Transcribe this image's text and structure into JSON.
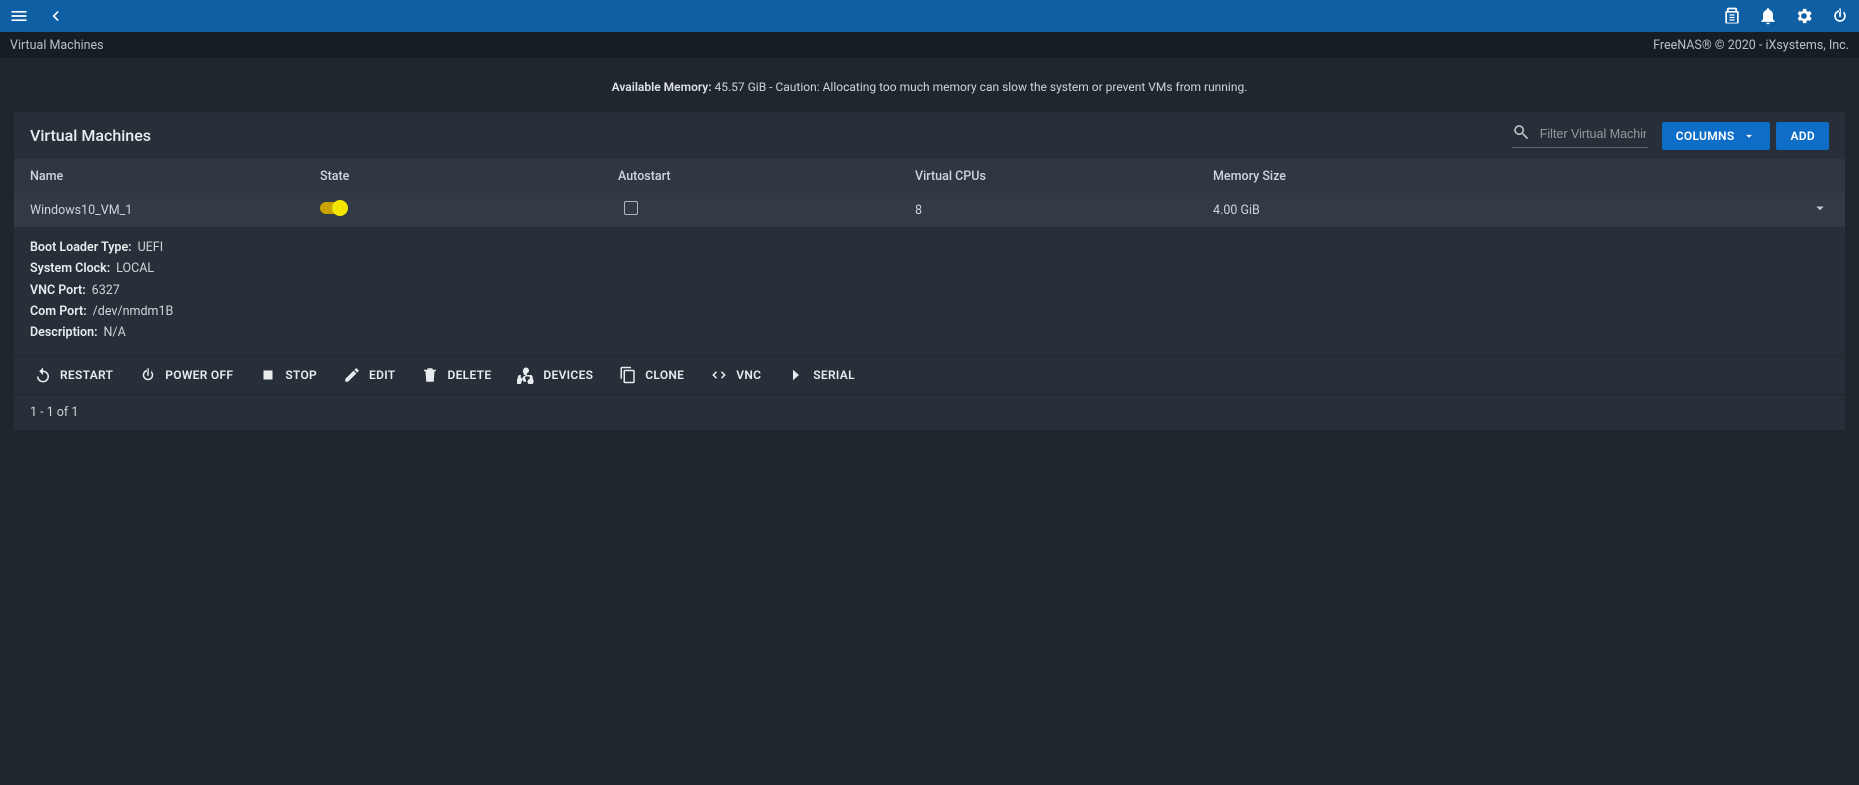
{
  "breadcrumb": "Virtual Machines",
  "copyright": "FreeNAS® © 2020 - iXsystems, Inc.",
  "memory_warning_label": "Available Memory:",
  "memory_warning_text": " 45.57 GiB - Caution: Allocating too much memory can slow the system or prevent VMs from running.",
  "panel": {
    "title": "Virtual Machines",
    "search_placeholder": "Filter Virtual Machines",
    "columns_button": "COLUMNS",
    "add_button": "ADD"
  },
  "table": {
    "headers": {
      "name": "Name",
      "state": "State",
      "autostart": "Autostart",
      "vcpu": "Virtual CPUs",
      "mem": "Memory Size"
    },
    "row": {
      "name": "Windows10_VM_1",
      "vcpu": "8",
      "mem": "4.00 GiB"
    }
  },
  "details": {
    "boot_loader_label": "Boot Loader Type:",
    "boot_loader_val": "UEFI",
    "system_clock_label": "System Clock:",
    "system_clock_val": "LOCAL",
    "vnc_port_label": "VNC Port:",
    "vnc_port_val": "6327",
    "com_port_label": "Com Port:",
    "com_port_val": "/dev/nmdm1B",
    "description_label": "Description:",
    "description_val": "N/A"
  },
  "actions": {
    "restart": "RESTART",
    "poweroff": "POWER OFF",
    "stop": "STOP",
    "edit": "EDIT",
    "delete": "DELETE",
    "devices": "DEVICES",
    "clone": "CLONE",
    "vnc": "VNC",
    "serial": "SERIAL"
  },
  "pager": "1 - 1 of 1"
}
